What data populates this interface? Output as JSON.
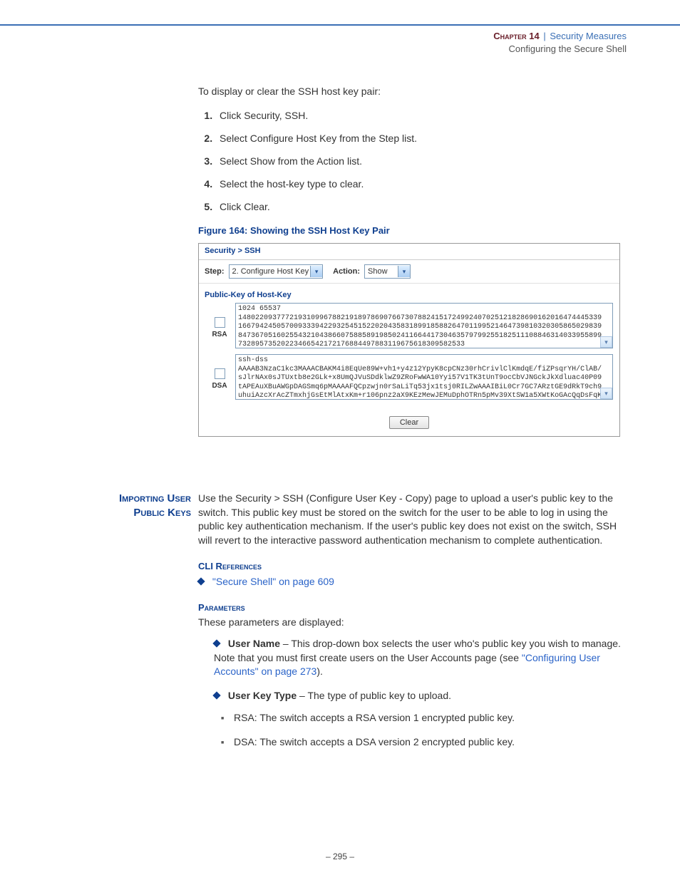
{
  "header": {
    "chapter": "Chapter 14",
    "divider": "|",
    "topic": "Security Measures",
    "subtopic": "Configuring the Secure Shell"
  },
  "intro": "To display or clear the SSH host key pair:",
  "steps": [
    "Click Security, SSH.",
    "Select Configure Host Key from the Step list.",
    "Select Show from the Action list.",
    "Select the host-key type to clear.",
    "Click Clear."
  ],
  "figure_caption": "Figure 164:  Showing the SSH Host Key Pair",
  "panel": {
    "breadcrumb": "Security > SSH",
    "step_label": "Step:",
    "step_value": "2. Configure Host Key",
    "action_label": "Action:",
    "action_value": "Show",
    "section_title": "Public-Key of Host-Key",
    "rsa_label": "RSA",
    "dsa_label": "DSA",
    "rsa_key": "1024 65537\n1480220937772193109967882191897869076673078824151724992407025121828690162016474445339\n1667942450570093339422932545152202043583189918588264701199521464739810320305865029839\n8473670516025543210438660758858919850241166441730463579799255182511108846314033955899\n73289573520223466542172176884497883119675618309582533",
    "dsa_key": "ssh-dss\nAAAAB3NzaC1kc3MAAACBAKM4i8EqUe89W+vh1+y4z12YpyK8cpCNz30rhCrivlClKmdqE/fiZPsqrYH/ClAB/\nsJlrNAx0sJTUxtb8e2GLk+x8UmQJVuSDdklwZ9ZRoFwWA10Yyi57V1TK3tUnT9ocCbVJNGckJkXdluac40P09\ntAPEAuXBuAWGpDAGSmq6pMAAAAFQCpzwjn0rSaLiTq53jx1tsj0RILZwAAAIBiL0Cr7GC7ARztGE9dRkT9ch9\nuhuiAzcXrAcZTmxhjGsEtMlAtxKm+r106pnz2aX9KEzMewJEMuDphOTRn5pMv39XtSW1a5XWtKoGAcQqDsFqK",
    "clear_button": "Clear"
  },
  "section2": {
    "side_heading_l1": "Importing User",
    "side_heading_l2": "Public Keys",
    "paragraph": "Use the Security > SSH (Configure User Key - Copy) page to upload a user's public key to the switch. This public key must be stored on the switch for the user to be able to log in using the public key authentication mechanism. If the user's public key does not exist on the switch, SSH will revert to the interactive password authentication mechanism to complete authentication.",
    "cli_ref_heading": "CLI References",
    "cli_ref_link": "\"Secure Shell\" on page 609",
    "params_heading": "Parameters",
    "params_intro": "These parameters are displayed:",
    "param1_name": "User Name",
    "param1_desc_a": " – This drop-down box selects the user who's public key you wish to manage. Note that you must first create users on the User Accounts page (see ",
    "param1_link": "\"Configuring User Accounts\" on page 273",
    "param1_desc_b": ").",
    "param2_name": "User Key Type",
    "param2_desc": " – The type of public key to upload.",
    "sub1": "RSA: The switch accepts a RSA version 1 encrypted public key.",
    "sub2": "DSA: The switch accepts a DSA version 2 encrypted public key."
  },
  "footer": "– 295 –"
}
